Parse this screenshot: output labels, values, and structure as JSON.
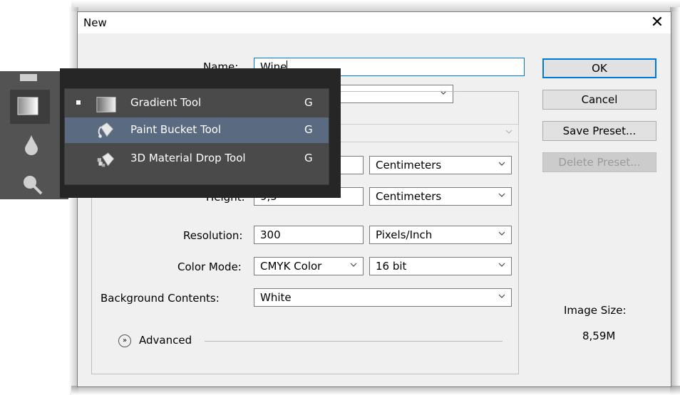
{
  "dialog": {
    "title": "New",
    "close_glyph": "✕",
    "name_label": "Name:",
    "name_value": "Wine",
    "preset_value": "",
    "size_value": "",
    "width_unit": "Centimeters",
    "height_label": "Height:",
    "height_value": "9,5",
    "height_unit": "Centimeters",
    "resolution_label": "Resolution:",
    "resolution_value": "300",
    "resolution_unit": "Pixels/Inch",
    "color_mode_label": "Color Mode:",
    "color_mode_value": "CMYK Color",
    "bit_depth_value": "16 bit",
    "background_label": "Background Contents:",
    "background_value": "White",
    "advanced_label": "Advanced",
    "image_size_label": "Image Size:",
    "image_size_value": "8,59M"
  },
  "buttons": {
    "ok": "OK",
    "cancel": "Cancel",
    "save_preset": "Save Preset...",
    "delete_preset": "Delete Preset..."
  },
  "tool_flyout": {
    "items": [
      {
        "label": "Gradient Tool",
        "shortcut": "G",
        "selected": true,
        "icon": "gradient-icon"
      },
      {
        "label": "Paint Bucket Tool",
        "shortcut": "G",
        "highlighted": true,
        "icon": "paint-bucket-icon"
      },
      {
        "label": "3D Material Drop Tool",
        "shortcut": "G",
        "icon": "3d-material-drop-icon"
      }
    ]
  },
  "colors": {
    "accent": "#0078d7",
    "flyout_bg": "#4a4a4a",
    "flyout_highlight": "#5a6a80",
    "toolbar_bg": "#535353"
  }
}
